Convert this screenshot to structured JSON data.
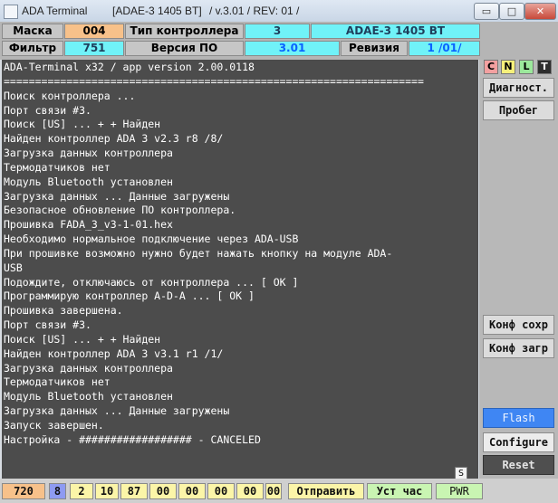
{
  "window": {
    "title_parts": [
      "ADA Terminal",
      "[ADAE-3 1405 BT]",
      "/ v.3.01 / REV: 01 /"
    ],
    "minimize": "▭",
    "maximize": "□",
    "close": "✕"
  },
  "info": {
    "mask_label": "Маска",
    "mask_value": "004",
    "filter_label": "Фильтр",
    "filter_value": "751",
    "controller_type_label": "Тип контроллера",
    "controller_type_num": "3",
    "controller_model": "ADAE-3 1405 BT",
    "sw_version_label": "Версия ПО",
    "sw_version_value": "3.01",
    "revision_label": "Ревизия",
    "revision_value": "1 /01/"
  },
  "terminal": {
    "lines": [
      "ADA-Terminal x32 / app version 2.00.0118",
      "===================================================================",
      "Поиск контроллера ...",
      "Порт связи #3.",
      "Поиск [US]   ... + + Найден",
      "Найден контроллер ADA 3 v2.3 r8  /8/",
      "Загрузка данных контроллера",
      "Термодатчиков нет",
      "Модуль Bluetooth установлен",
      "Загрузка данных ... Данные загружены",
      "Безопасное обновление ПО контроллера.",
      "Прошивка FADA_3_v3-1-01.hex",
      "Необходимо нормальное подключение через ADA-USB",
      "При прошивке возможно нужно будет нажать кнопку на модуле ADA-",
      "USB",
      "Подождите, отключаюсь от контроллера ... [  OK   ]",
      "Программирую контроллер A-D-A   ...          [  OK   ]",
      "Прошивка завершена.",
      "Порт связи #3.",
      "Поиск [US]   ... + + Найден",
      "Найден контроллер ADA 3 v3.1 r1  /1/",
      "Загрузка данных контроллера",
      "Термодатчиков нет",
      "Модуль Bluetooth установлен",
      "Загрузка данных ... Данные загружены",
      "Запуск завершен.",
      "Настройка - ################## - CANCELED"
    ],
    "scroll_label": "S"
  },
  "right_panel": {
    "modes": [
      "C",
      "N",
      "L",
      "T"
    ],
    "mode_colors": [
      "#f3a0a0",
      "#f6f07a",
      "#9be89b",
      "#2d2d2d"
    ],
    "diag_label": "Диагност.",
    "mileage_label": "Пробег",
    "conf_save_label": "Конф сохр",
    "conf_load_label": "Конф загр",
    "flash_label": "Flash",
    "configure_label": "Configure",
    "reset_label": "Reset"
  },
  "status": {
    "value_720": "720",
    "value_8": "8",
    "bytes": [
      "2",
      "10",
      "87",
      "00",
      "00",
      "00",
      "00",
      "00"
    ],
    "send_label": "Отправить",
    "set_time_label": "Уст час",
    "pwr_label": "PWR"
  }
}
